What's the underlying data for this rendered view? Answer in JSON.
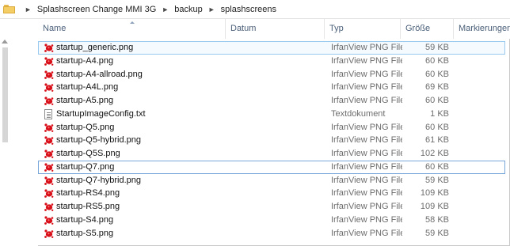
{
  "breadcrumb": [
    "Splashscreen Change MMI 3G",
    "backup",
    "splashscreens"
  ],
  "columns": {
    "name": "Name",
    "date": "Datum",
    "type": "Typ",
    "size": "Größe",
    "tags": "Markierungen"
  },
  "files": [
    {
      "name": "startup_generic.png",
      "type": "IrfanView PNG File",
      "size": "59 KB",
      "icon": "irfanview-png-icon"
    },
    {
      "name": "startup-A4.png",
      "type": "IrfanView PNG File",
      "size": "60 KB",
      "icon": "irfanview-png-icon"
    },
    {
      "name": "startup-A4-allroad.png",
      "type": "IrfanView PNG File",
      "size": "60 KB",
      "icon": "irfanview-png-icon"
    },
    {
      "name": "startup-A4L.png",
      "type": "IrfanView PNG File",
      "size": "69 KB",
      "icon": "irfanview-png-icon"
    },
    {
      "name": "startup-A5.png",
      "type": "IrfanView PNG File",
      "size": "60 KB",
      "icon": "irfanview-png-icon"
    },
    {
      "name": "StartupImageConfig.txt",
      "type": "Textdokument",
      "size": "1 KB",
      "icon": "text-document-icon"
    },
    {
      "name": "startup-Q5.png",
      "type": "IrfanView PNG File",
      "size": "60 KB",
      "icon": "irfanview-png-icon"
    },
    {
      "name": "startup-Q5-hybrid.png",
      "type": "IrfanView PNG File",
      "size": "61 KB",
      "icon": "irfanview-png-icon"
    },
    {
      "name": "startup-Q5S.png",
      "type": "IrfanView PNG File",
      "size": "102 KB",
      "icon": "irfanview-png-icon"
    },
    {
      "name": "startup-Q7.png",
      "type": "IrfanView PNG File",
      "size": "60 KB",
      "icon": "irfanview-png-icon"
    },
    {
      "name": "startup-Q7-hybrid.png",
      "type": "IrfanView PNG File",
      "size": "59 KB",
      "icon": "irfanview-png-icon"
    },
    {
      "name": "startup-RS4.png",
      "type": "IrfanView PNG File",
      "size": "109 KB",
      "icon": "irfanview-png-icon"
    },
    {
      "name": "startup-RS5.png",
      "type": "IrfanView PNG File",
      "size": "109 KB",
      "icon": "irfanview-png-icon"
    },
    {
      "name": "startup-S4.png",
      "type": "IrfanView PNG File",
      "size": "58 KB",
      "icon": "irfanview-png-icon"
    },
    {
      "name": "startup-S5.png",
      "type": "IrfanView PNG File",
      "size": "59 KB",
      "icon": "irfanview-png-icon"
    }
  ],
  "selected_index": 0,
  "focused_index": 9,
  "colors": {
    "selection_border": "#99c9ef",
    "header_text": "#4c607a",
    "irfanview_red": "#d8101a"
  }
}
